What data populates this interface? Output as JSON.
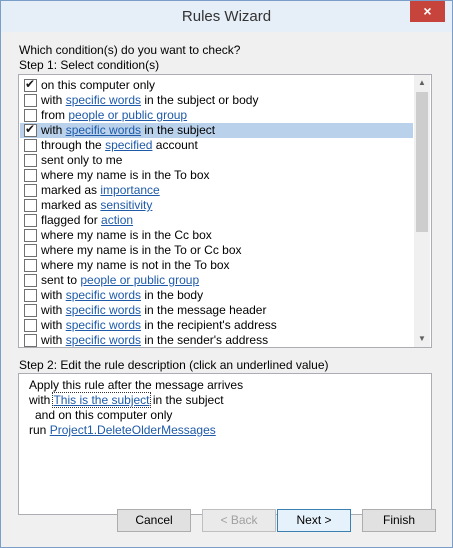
{
  "window": {
    "title": "Rules Wizard",
    "close_glyph": "×"
  },
  "step1": {
    "question": "Which condition(s) do you want to check?",
    "label": "Step 1: Select condition(s)",
    "conditions": [
      {
        "checked": true,
        "selected": false,
        "parts": [
          {
            "t": "on this computer only"
          }
        ]
      },
      {
        "checked": false,
        "selected": false,
        "parts": [
          {
            "t": "with "
          },
          {
            "t": "specific words",
            "link": true
          },
          {
            "t": " in the subject or body"
          }
        ]
      },
      {
        "checked": false,
        "selected": false,
        "parts": [
          {
            "t": "from "
          },
          {
            "t": "people or public group",
            "link": true
          }
        ]
      },
      {
        "checked": true,
        "selected": true,
        "parts": [
          {
            "t": "with "
          },
          {
            "t": "specific words",
            "link": true
          },
          {
            "t": " in the subject"
          }
        ]
      },
      {
        "checked": false,
        "selected": false,
        "parts": [
          {
            "t": "through the "
          },
          {
            "t": "specified",
            "link": true
          },
          {
            "t": " account"
          }
        ]
      },
      {
        "checked": false,
        "selected": false,
        "parts": [
          {
            "t": "sent only to me"
          }
        ]
      },
      {
        "checked": false,
        "selected": false,
        "parts": [
          {
            "t": "where my name is in the To box"
          }
        ]
      },
      {
        "checked": false,
        "selected": false,
        "parts": [
          {
            "t": "marked as "
          },
          {
            "t": "importance",
            "link": true
          }
        ]
      },
      {
        "checked": false,
        "selected": false,
        "parts": [
          {
            "t": "marked as "
          },
          {
            "t": "sensitivity",
            "link": true
          }
        ]
      },
      {
        "checked": false,
        "selected": false,
        "parts": [
          {
            "t": "flagged for "
          },
          {
            "t": "action",
            "link": true
          }
        ]
      },
      {
        "checked": false,
        "selected": false,
        "parts": [
          {
            "t": "where my name is in the Cc box"
          }
        ]
      },
      {
        "checked": false,
        "selected": false,
        "parts": [
          {
            "t": "where my name is in the To or Cc box"
          }
        ]
      },
      {
        "checked": false,
        "selected": false,
        "parts": [
          {
            "t": "where my name is not in the To box"
          }
        ]
      },
      {
        "checked": false,
        "selected": false,
        "parts": [
          {
            "t": "sent to "
          },
          {
            "t": "people or public group",
            "link": true
          }
        ]
      },
      {
        "checked": false,
        "selected": false,
        "parts": [
          {
            "t": "with "
          },
          {
            "t": "specific words",
            "link": true
          },
          {
            "t": " in the body"
          }
        ]
      },
      {
        "checked": false,
        "selected": false,
        "parts": [
          {
            "t": "with "
          },
          {
            "t": "specific words",
            "link": true
          },
          {
            "t": " in the message header"
          }
        ]
      },
      {
        "checked": false,
        "selected": false,
        "parts": [
          {
            "t": "with "
          },
          {
            "t": "specific words",
            "link": true
          },
          {
            "t": " in the recipient's address"
          }
        ]
      },
      {
        "checked": false,
        "selected": false,
        "parts": [
          {
            "t": "with "
          },
          {
            "t": "specific words",
            "link": true
          },
          {
            "t": " in the sender's address"
          }
        ]
      }
    ]
  },
  "step2": {
    "label": "Step 2: Edit the rule description (click an underlined value)",
    "line1": "Apply this rule after the message arrives",
    "line2_prefix": "with ",
    "line2_link": "This is the subject",
    "line2_suffix": " in the subject",
    "line3": "and on this computer only",
    "line4_prefix": "run ",
    "line4_link": "Project1.DeleteOlderMessages"
  },
  "buttons": {
    "cancel": "Cancel",
    "back": "< Back",
    "next": "Next >",
    "finish": "Finish"
  },
  "icons": {
    "check": "✔",
    "scroll_up": "▲",
    "scroll_down": "▼"
  }
}
